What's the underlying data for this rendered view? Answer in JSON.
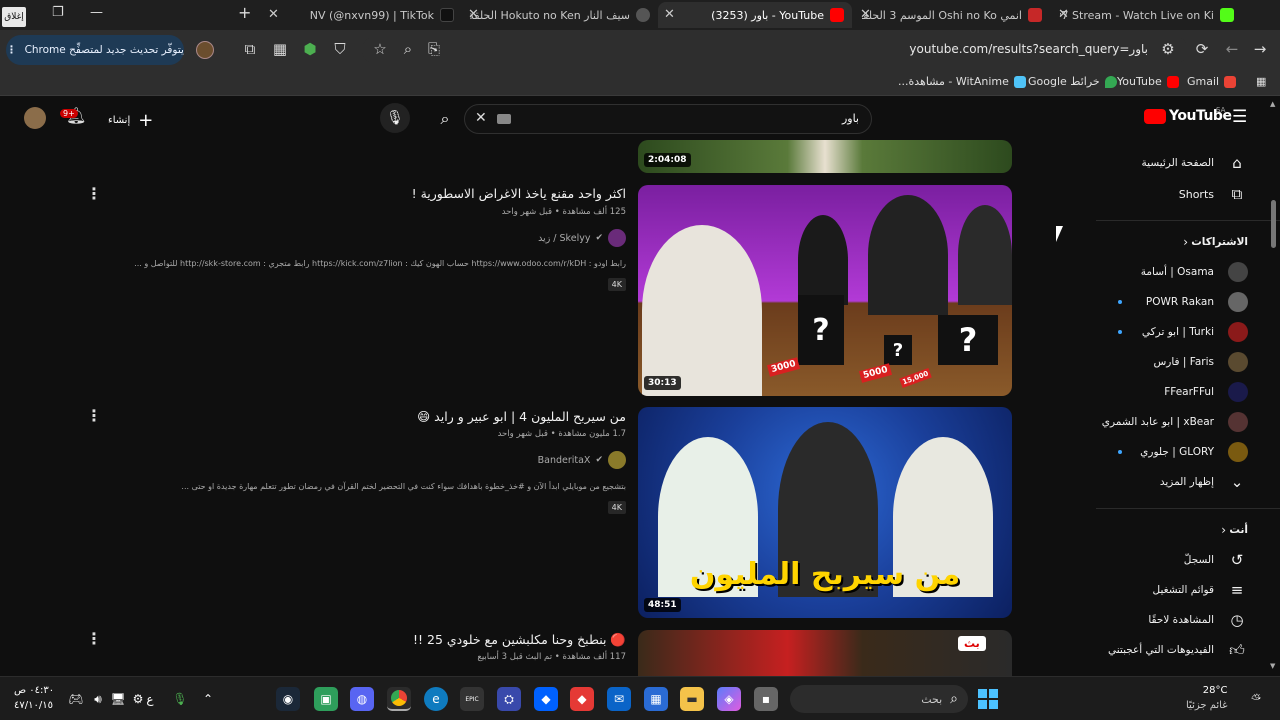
{
  "corner_label": "إغلاق",
  "tabs": [
    {
      "title": "Nxv7 Stream - Watch Live on Ki",
      "color": "#53fc18",
      "active": false
    },
    {
      "title": "انمي Oshi no Ko الموسم 3 الحلقة",
      "color": "#c62828",
      "active": false
    },
    {
      "title": "YouTube - باور (3253)",
      "color": "#ff0000",
      "active": true
    },
    {
      "title": "سيف النار Hokuto no Ken الحلقة",
      "color": "#555555",
      "active": false
    },
    {
      "title": "NV (@nxvn99) | TikTok",
      "color": "#111111",
      "active": false
    }
  ],
  "new_tab_label": "+",
  "update_chip": "يتوفّر تحديث جديد لمتصفِّح Chrome",
  "url": "youtube.com/results?search_query=باور",
  "bookmarks": [
    {
      "label": "Gmail",
      "color": "#ea4335"
    },
    {
      "label": "YouTube",
      "color": "#ff0000"
    },
    {
      "label": "خرائط Google",
      "color": "#34a853"
    },
    {
      "label": "WitAnime - مشاهدة...",
      "color": "#4fc3f7"
    }
  ],
  "yt": {
    "logo_text": "YouTube",
    "region": "SA",
    "search_value": "باور",
    "create_label": "إنشاء",
    "notif_count": "9+"
  },
  "sidebar": {
    "home": "الصفحة الرئيسية",
    "shorts": "Shorts",
    "subs_header": "الاشتراكات",
    "subs": [
      {
        "name": "Osama | أسامة",
        "color": "#444",
        "live": false
      },
      {
        "name": "POWR Rakan",
        "color": "#666",
        "live": true
      },
      {
        "name": "Turki | ابو تركي",
        "color": "#8b1a1a",
        "live": true
      },
      {
        "name": "Faris | فارس",
        "color": "#5a4a30",
        "live": false
      },
      {
        "name": "FFearFFul",
        "color": "#1a1a4a",
        "live": false
      },
      {
        "name": "xBear | ابو عابد الشمري",
        "color": "#553333",
        "live": false
      },
      {
        "name": "GLORY | جلوري",
        "color": "#7a5a10",
        "live": true
      }
    ],
    "show_more": "إظهار المزيد",
    "you_header": "أنت",
    "you_items": [
      "السجلّ",
      "قوائم التشغيل",
      "المشاهدة لاحقًا",
      "الفيديوهات التي أعجبتني"
    ]
  },
  "results": [
    {
      "duration": "2:04:08"
    },
    {
      "title": "اكثر واحد مقنع ياخذ الاغراض الاسطورية !",
      "meta": "125 ألف مشاهدة • قبل شهر واحد",
      "channel": "Skelyy / زيد",
      "description": "رابط اودو : https://www.odoo.com/r/kDH حساب الهون كيك : https://kick.com/z7lion رابط متجري : http://skk-store.com للتواصل و ...",
      "badge": "4K",
      "duration": "30:13",
      "thumb_prices": [
        "3000",
        "5000",
        "15,000"
      ]
    },
    {
      "title": "من سيربح المليون 4 | ابو عبير و رايد 😄",
      "meta": "1.7 مليون مشاهدة • قبل شهر واحد",
      "channel": "BanderitaX",
      "description": "بتشجيع من موبايلي ابدأ الآن و #خذ_خطوة باهدافك سواء كنت في التحضير لختم القرآن في رمضان تطور تتعلم مهارة جديدة او حتى ...",
      "badge": "4K",
      "duration": "48:51",
      "thumb_text": "من سيربح المليون"
    },
    {
      "title": "🔴 بنطبخ وحنا مكلبشين مع خلودي 25 !!",
      "meta": "117 ألف مشاهدة • تم البث قبل 3 أسابيع",
      "thumb_badge": "بث"
    }
  ],
  "taskbar": {
    "search_placeholder": "بحث",
    "weather_temp": "28°C",
    "weather_desc": "غائم جزئيًا",
    "time": "٠٤:٣٠ ص",
    "date": "٤٧/١٠/١٥",
    "lang": "ع"
  }
}
